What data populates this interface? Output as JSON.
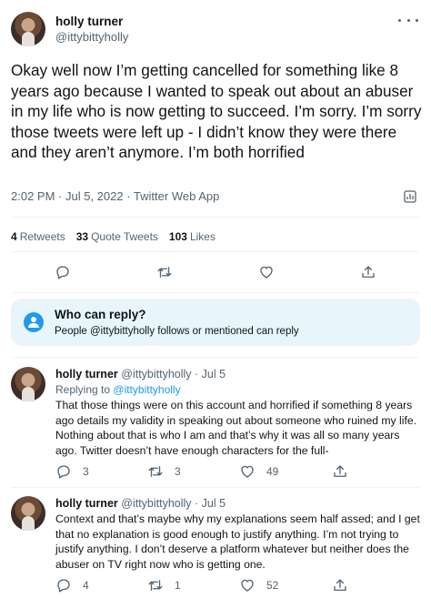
{
  "main_tweet": {
    "display_name": "holly turner",
    "handle": "@ittybittyholly",
    "text": "Okay well now I’m getting cancelled for something like 8 years ago because I wanted to speak out about an abuser in my life who is now getting to succeed. I’m sorry. I’m sorry those tweets were left up - I didn’t know they were there and they aren’t anymore. I’m both horrified",
    "time": "2:02 PM",
    "date": "Jul 5, 2022",
    "source": "Twitter Web App",
    "stats": {
      "retweets_count": "4",
      "retweets_label": "Retweets",
      "quotes_count": "33",
      "quotes_label": "Quote Tweets",
      "likes_count": "103",
      "likes_label": "Likes"
    }
  },
  "who_can_reply": {
    "title": "Who can reply?",
    "subtitle": "People @ittybittyholly follows or mentioned can reply"
  },
  "replies": [
    {
      "display_name": "holly turner",
      "handle": "@ittybittyholly",
      "date": "Jul 5",
      "replying_prefix": "Replying to",
      "replying_to": "@ittybittyholly",
      "text": "That those things were on this account and horrified if something 8 years ago details my validity in speaking out about someone who ruined my life. Nothing about that is who I am and that’s why it was all so many years ago. Twitter doesn’t have enough characters for the full-",
      "reply_count": "3",
      "retweet_count": "3",
      "like_count": "49"
    },
    {
      "display_name": "holly turner",
      "handle": "@ittybittyholly",
      "date": "Jul 5",
      "text": "Context and that’s maybe why my explanations seem half assed; and I get that no explanation is good enough to justify anything. I’m not trying to justify anything. I don’t deserve a platform whatever but neither does the abuser on TV right now who is getting one.",
      "reply_count": "4",
      "retweet_count": "1",
      "like_count": "52"
    }
  ],
  "icons": [
    "more-icon",
    "analytics-icon",
    "reply-icon",
    "retweet-icon",
    "like-icon",
    "share-icon",
    "person-icon"
  ],
  "colors": {
    "accent": "#1d9bf0",
    "secondary_text": "#536471",
    "reply_box_bg": "#e8f5fd"
  }
}
